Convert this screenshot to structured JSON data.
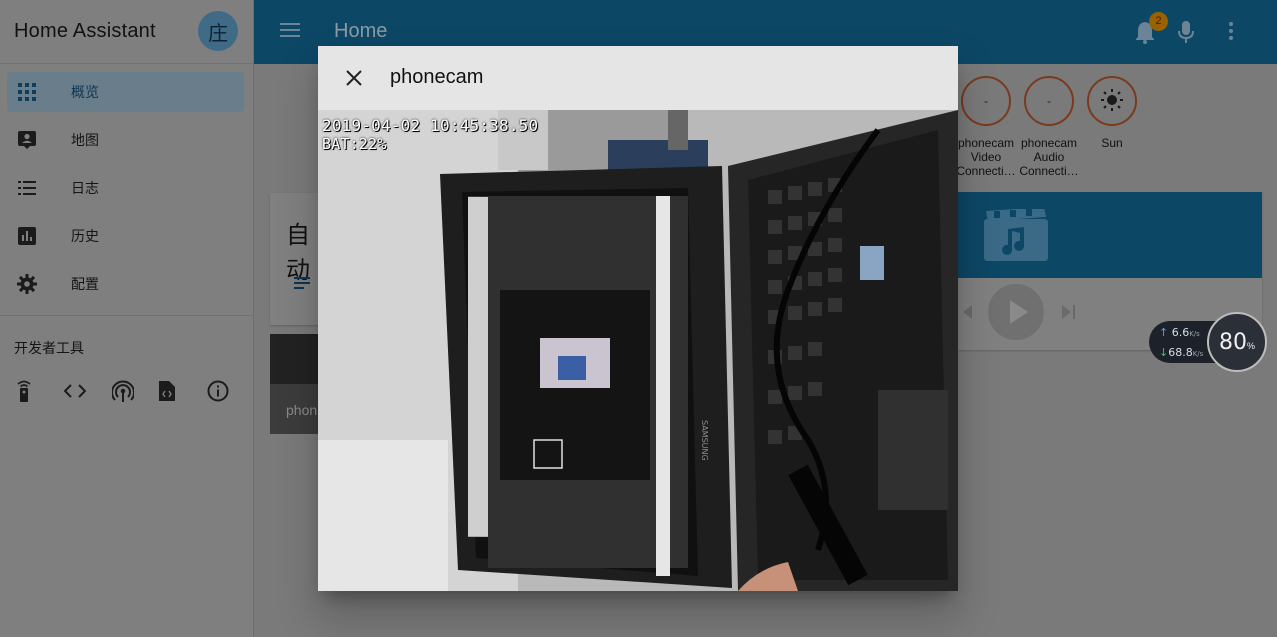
{
  "sidebar": {
    "title": "Home Assistant",
    "avatar_initial": "庄",
    "items": [
      {
        "label": "概览",
        "icon": "grid-icon"
      },
      {
        "label": "地图",
        "icon": "account-box-icon"
      },
      {
        "label": "日志",
        "icon": "list-icon"
      },
      {
        "label": "历史",
        "icon": "chart-icon"
      },
      {
        "label": "配置",
        "icon": "gear-icon"
      }
    ],
    "dev_tools_label": "开发者工具",
    "dev_tools": [
      "remote-icon",
      "code-icon",
      "broadcast-icon",
      "file-code-icon",
      "info-icon"
    ]
  },
  "appbar": {
    "title": "Home",
    "notification_count": "2"
  },
  "badges": [
    {
      "value": "-",
      "label": "phonecam Video Connecti…"
    },
    {
      "value": "-",
      "label": "phonecam Audio Connecti…"
    },
    {
      "value": "",
      "label": "Sun",
      "icon": "sun-icon"
    }
  ],
  "background_cards": {
    "automation_title_partial": "自动",
    "camera_name_partial": "phon"
  },
  "net_widget": {
    "upload": "6.6",
    "download": "68.8",
    "unit": "K/s",
    "percent": "80",
    "percent_unit": "%"
  },
  "dialog": {
    "title": "phonecam",
    "timestamp": "2019-04-02 10:45:38.50",
    "battery": "BAT:22%"
  },
  "colors": {
    "primary": "#03a9f4",
    "overlay_dim": "#7a7a7a",
    "dialog_bg": "#e5e5e5"
  }
}
